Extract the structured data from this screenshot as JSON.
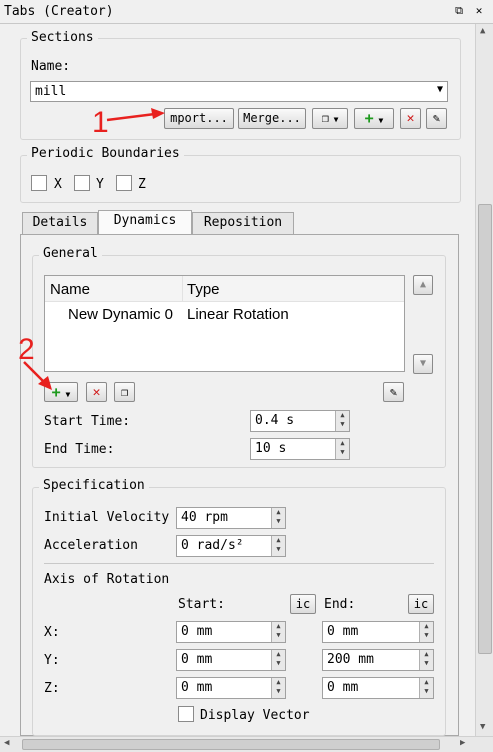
{
  "window": {
    "title": "Tabs (Creator)"
  },
  "sections": {
    "legend": "Sections",
    "name_label": "Name:",
    "name_value": "mill",
    "import_label": "mport...",
    "merge_label": "Merge..."
  },
  "periodic": {
    "legend": "Periodic Boundaries",
    "x": "X",
    "y": "Y",
    "z": "Z"
  },
  "tabs": [
    "Details",
    "Dynamics",
    "Reposition"
  ],
  "general": {
    "legend": "General",
    "columns": [
      "Name",
      "Type"
    ],
    "rows": [
      {
        "name": "New Dynamic 0",
        "type": "Linear Rotation"
      }
    ],
    "start_time_label": "Start Time:",
    "start_time_value": "0.4 s",
    "end_time_label": "End Time:",
    "end_time_value": "10 s"
  },
  "specification": {
    "legend": "Specification",
    "initial_velocity_label": "Initial Velocity",
    "initial_velocity_value": "40 rpm",
    "acceleration_label": "Acceleration",
    "acceleration_value": "0 rad/s²",
    "axis_label": "Axis of Rotation",
    "start_label": "Start:",
    "end_label": "End:",
    "ic_label": "ic",
    "x_label": "X:",
    "y_label": "Y:",
    "z_label": "Z:",
    "start_x": "0 mm",
    "start_y": "0 mm",
    "start_z": "0 mm",
    "end_x": "0 mm",
    "end_y": "200 mm",
    "end_z": "0 mm",
    "display_vector_label": "Display Vector"
  },
  "annotations": {
    "one": "1",
    "two": "2"
  },
  "colors": {
    "annotation": "#e8211f"
  }
}
